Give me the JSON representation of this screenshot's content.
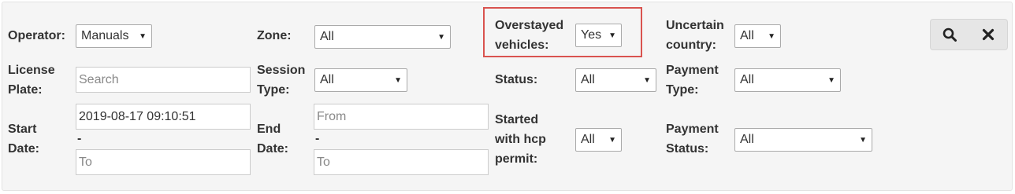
{
  "filters": {
    "operator": {
      "label": "Operator:",
      "value": "Manuals"
    },
    "zone": {
      "label": "Zone:",
      "value": "All"
    },
    "overstayed": {
      "label_line1": "Overstayed",
      "label_line2": "vehicles:",
      "value": "Yes"
    },
    "uncertain_country": {
      "label_line1": "Uncertain",
      "label_line2": "country:",
      "value": "All"
    },
    "license_plate": {
      "label_line1": "License",
      "label_line2": "Plate:",
      "placeholder": "Search"
    },
    "session_type": {
      "label_line1": "Session",
      "label_line2": "Type:",
      "value": "All"
    },
    "status": {
      "label": "Status:",
      "value": "All"
    },
    "payment_type": {
      "label_line1": "Payment",
      "label_line2": "Type:",
      "value": "All"
    },
    "start_date": {
      "label_line1": "Start",
      "label_line2": "Date:",
      "from_value": "2019-08-17 09:10:51",
      "separator": "-",
      "to_placeholder": "To"
    },
    "end_date": {
      "label_line1": "End",
      "label_line2": "Date:",
      "from_placeholder": "From",
      "separator": "-",
      "to_placeholder": "To"
    },
    "started_hcp": {
      "label_line1": "Started",
      "label_line2": "with hcp",
      "label_line3": "permit:",
      "value": "All"
    },
    "payment_status": {
      "label_line1": "Payment",
      "label_line2": "Status:",
      "value": "All"
    }
  },
  "actions": {
    "search_icon": "search-icon",
    "clear_icon": "close-icon"
  },
  "colors": {
    "highlight": "#d9534f",
    "panel_bg": "#f5f5f5"
  }
}
